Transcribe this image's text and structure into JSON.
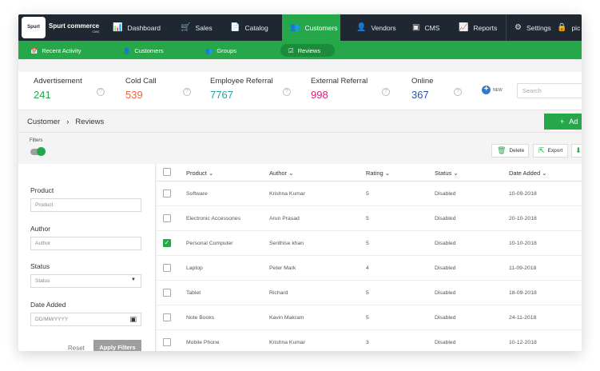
{
  "brand": {
    "badge": "Spurt",
    "name": "Spurt commerce",
    "sub": "CMS"
  },
  "nav": [
    {
      "icon": "📊",
      "label": "Dashboard",
      "active": false
    },
    {
      "icon": "🛒",
      "label": "Sales",
      "active": false
    },
    {
      "icon": "📄",
      "label": "Catalog",
      "active": false
    },
    {
      "icon": "👥",
      "label": "Customers",
      "active": true
    },
    {
      "icon": "👤",
      "label": "Vendors",
      "active": false
    },
    {
      "icon": "▣",
      "label": "CMS",
      "active": false
    },
    {
      "icon": "📈",
      "label": "Reports",
      "active": false
    },
    {
      "icon": "⚙",
      "label": "Settings",
      "active": false
    },
    {
      "icon": "🔒",
      "label": "pic",
      "active": false
    }
  ],
  "subnav": [
    {
      "icon": "📅",
      "label": "Recent Activity",
      "active": false
    },
    {
      "icon": "👤",
      "label": "Customers",
      "active": false
    },
    {
      "icon": "👥",
      "label": "Groups",
      "active": false
    },
    {
      "icon": "☑",
      "label": "Reviews",
      "active": true
    }
  ],
  "stats": [
    {
      "label": "Advertisement",
      "value": "241",
      "color": "#25a74a"
    },
    {
      "label": "Cold Call",
      "value": "539",
      "color": "#f0633a"
    },
    {
      "label": "Employee Referral",
      "value": "7767",
      "color": "#1fa3a3"
    },
    {
      "label": "External Referral",
      "value": "998",
      "color": "#e0197d"
    },
    {
      "label": "Online",
      "value": "367",
      "color": "#2a4fb5"
    }
  ],
  "new_label": "NEW",
  "search_placeholder": "Search",
  "breadcrumb": {
    "parent": "Customer",
    "separator": "›",
    "current": "Reviews"
  },
  "add_label": "Ad",
  "filters_label": "Filters",
  "toolbar": {
    "delete": "Delete",
    "export": "Export"
  },
  "filter_form": {
    "product_label": "Product",
    "product_placeholder": "Product",
    "author_label": "Author",
    "author_placeholder": "Author",
    "status_label": "Status",
    "status_value": "Status",
    "date_label": "Date Added",
    "date_placeholder": "DD/MM/YYYY",
    "reset": "Reset",
    "apply": "Apply Filters"
  },
  "table": {
    "headers": {
      "product": "Product",
      "author": "Author",
      "rating": "Rating",
      "status": "Status",
      "date": "Date Added"
    },
    "rows": [
      {
        "product": "Software",
        "author": "Krishna Kumar",
        "rating": "5",
        "status": "Disabled",
        "date": "10-09-2018",
        "checked": false
      },
      {
        "product": "Electronic Accessories",
        "author": "Arun Prasad",
        "rating": "5",
        "status": "Disabled",
        "date": "20-10-2018",
        "checked": false
      },
      {
        "product": "Personal Computer",
        "author": "Senthise khan",
        "rating": "5",
        "status": "Disabled",
        "date": "10-10-2018",
        "checked": true
      },
      {
        "product": "Laptop",
        "author": "Peter Mark",
        "rating": "4",
        "status": "Disabled",
        "date": "11-09-2018",
        "checked": false
      },
      {
        "product": "Tablet",
        "author": "Richard",
        "rating": "5",
        "status": "Disabled",
        "date": "18-09-2018",
        "checked": false
      },
      {
        "product": "Note Books",
        "author": "Kavin Makram",
        "rating": "5",
        "status": "Disabled",
        "date": "24-11-2018",
        "checked": false
      },
      {
        "product": "Mobile Phone",
        "author": "Krishna Kumar",
        "rating": "3",
        "status": "Disabled",
        "date": "10-12-2018",
        "checked": false
      }
    ]
  }
}
